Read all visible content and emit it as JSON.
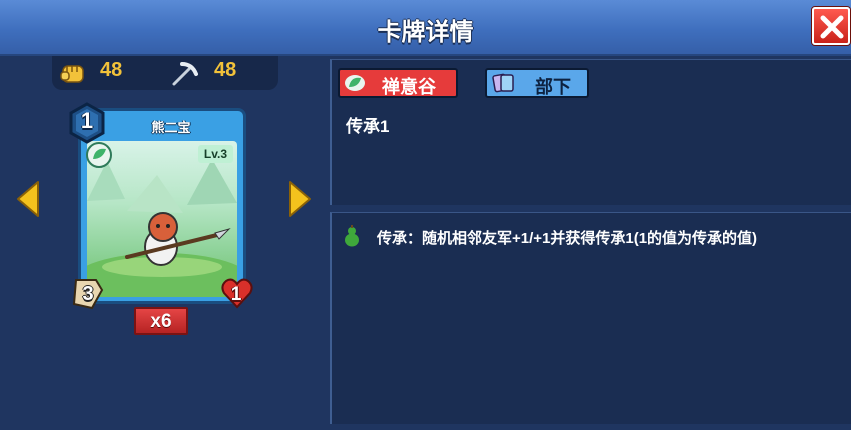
{
  "window": {
    "title": "卡牌详情"
  },
  "resources": [
    {
      "icon": "fist-icon",
      "value": "48"
    },
    {
      "icon": "pickaxe-icon",
      "value": "48"
    }
  ],
  "card": {
    "name": "熊二宝",
    "cost": "1",
    "level": "Lv.3",
    "attack": "3",
    "health": "1",
    "count": "x6"
  },
  "tags": [
    {
      "label": "禅意谷",
      "bg": "#e63b3b",
      "fg": "#ffffff"
    },
    {
      "label": "部下",
      "bg": "#5aa7ea",
      "fg": "#0d2240"
    }
  ],
  "keyword": "传承1",
  "effect": "传承：随机相邻友军+1/+1并获得传承1(1的值为传承的值)",
  "colors": {
    "accent": "#f2c23a",
    "panel": "#1a2d52",
    "background": "#1f3560"
  }
}
